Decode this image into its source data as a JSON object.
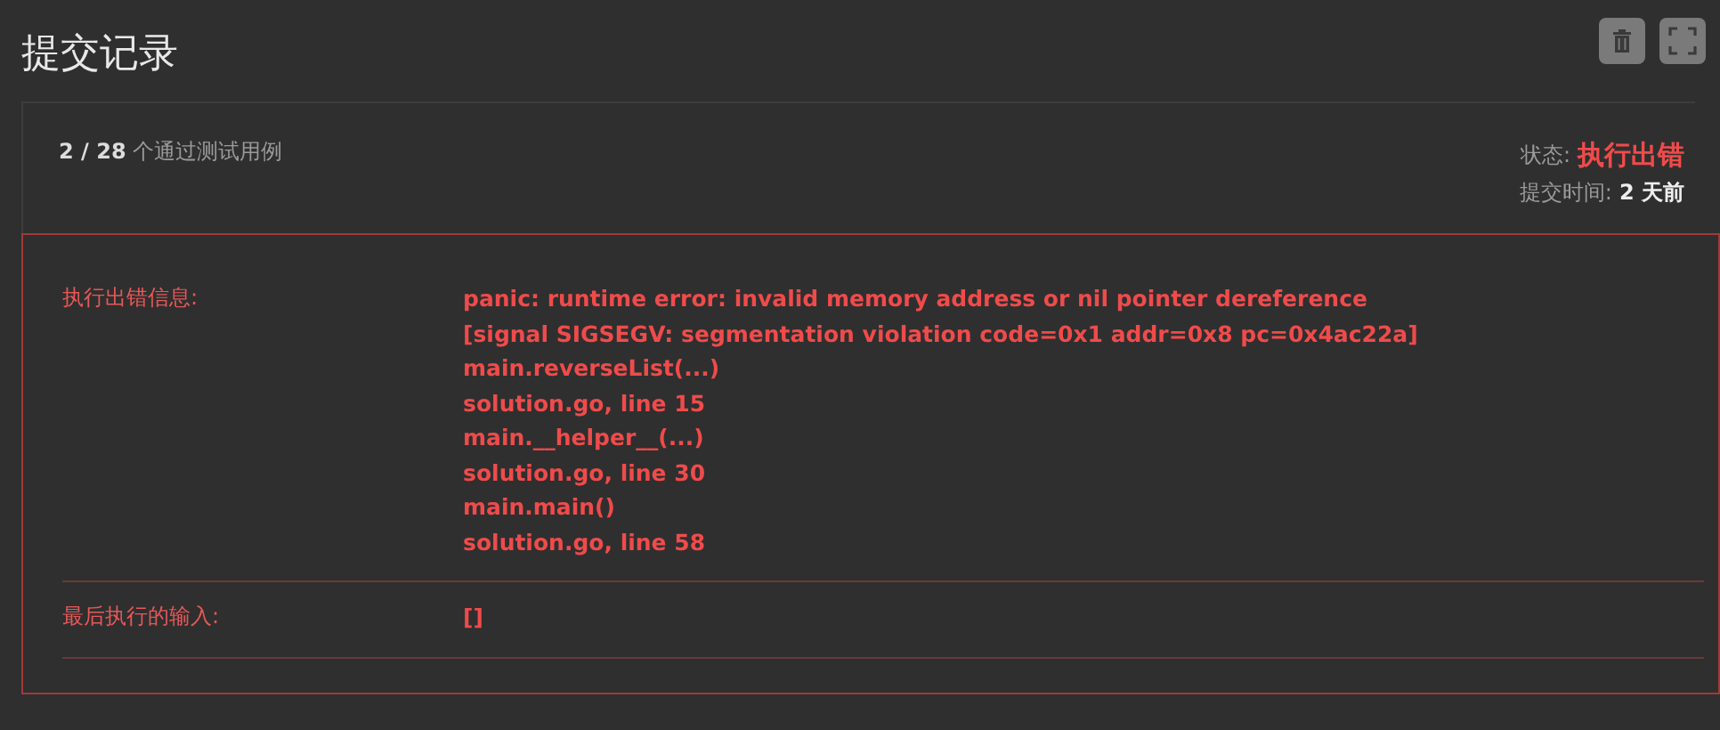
{
  "page": {
    "title": "提交记录"
  },
  "toolbar": [
    {
      "kind": "delete"
    },
    {
      "kind": "fullscreen"
    }
  ],
  "summary": {
    "passed": "2 / 28",
    "passed_label": "个通过测试用例",
    "status_label": "状态:",
    "status": "执行出错",
    "time_label": "提交时间:",
    "time": "2 天前"
  },
  "error_rows": [
    {
      "label": "执行出错信息:",
      "lines": [
        "panic: runtime error: invalid memory address or nil pointer dereference",
        "[signal SIGSEGV: segmentation violation code=0x1 addr=0x8 pc=0x4ac22a]",
        "main.reverseList(...)",
        "solution.go, line 15",
        "main.__helper__(...)",
        "solution.go, line 30",
        "main.main()",
        "solution.go, line 58"
      ]
    },
    {
      "label": "最后执行的输入:",
      "lines": [
        "[]"
      ]
    }
  ]
}
